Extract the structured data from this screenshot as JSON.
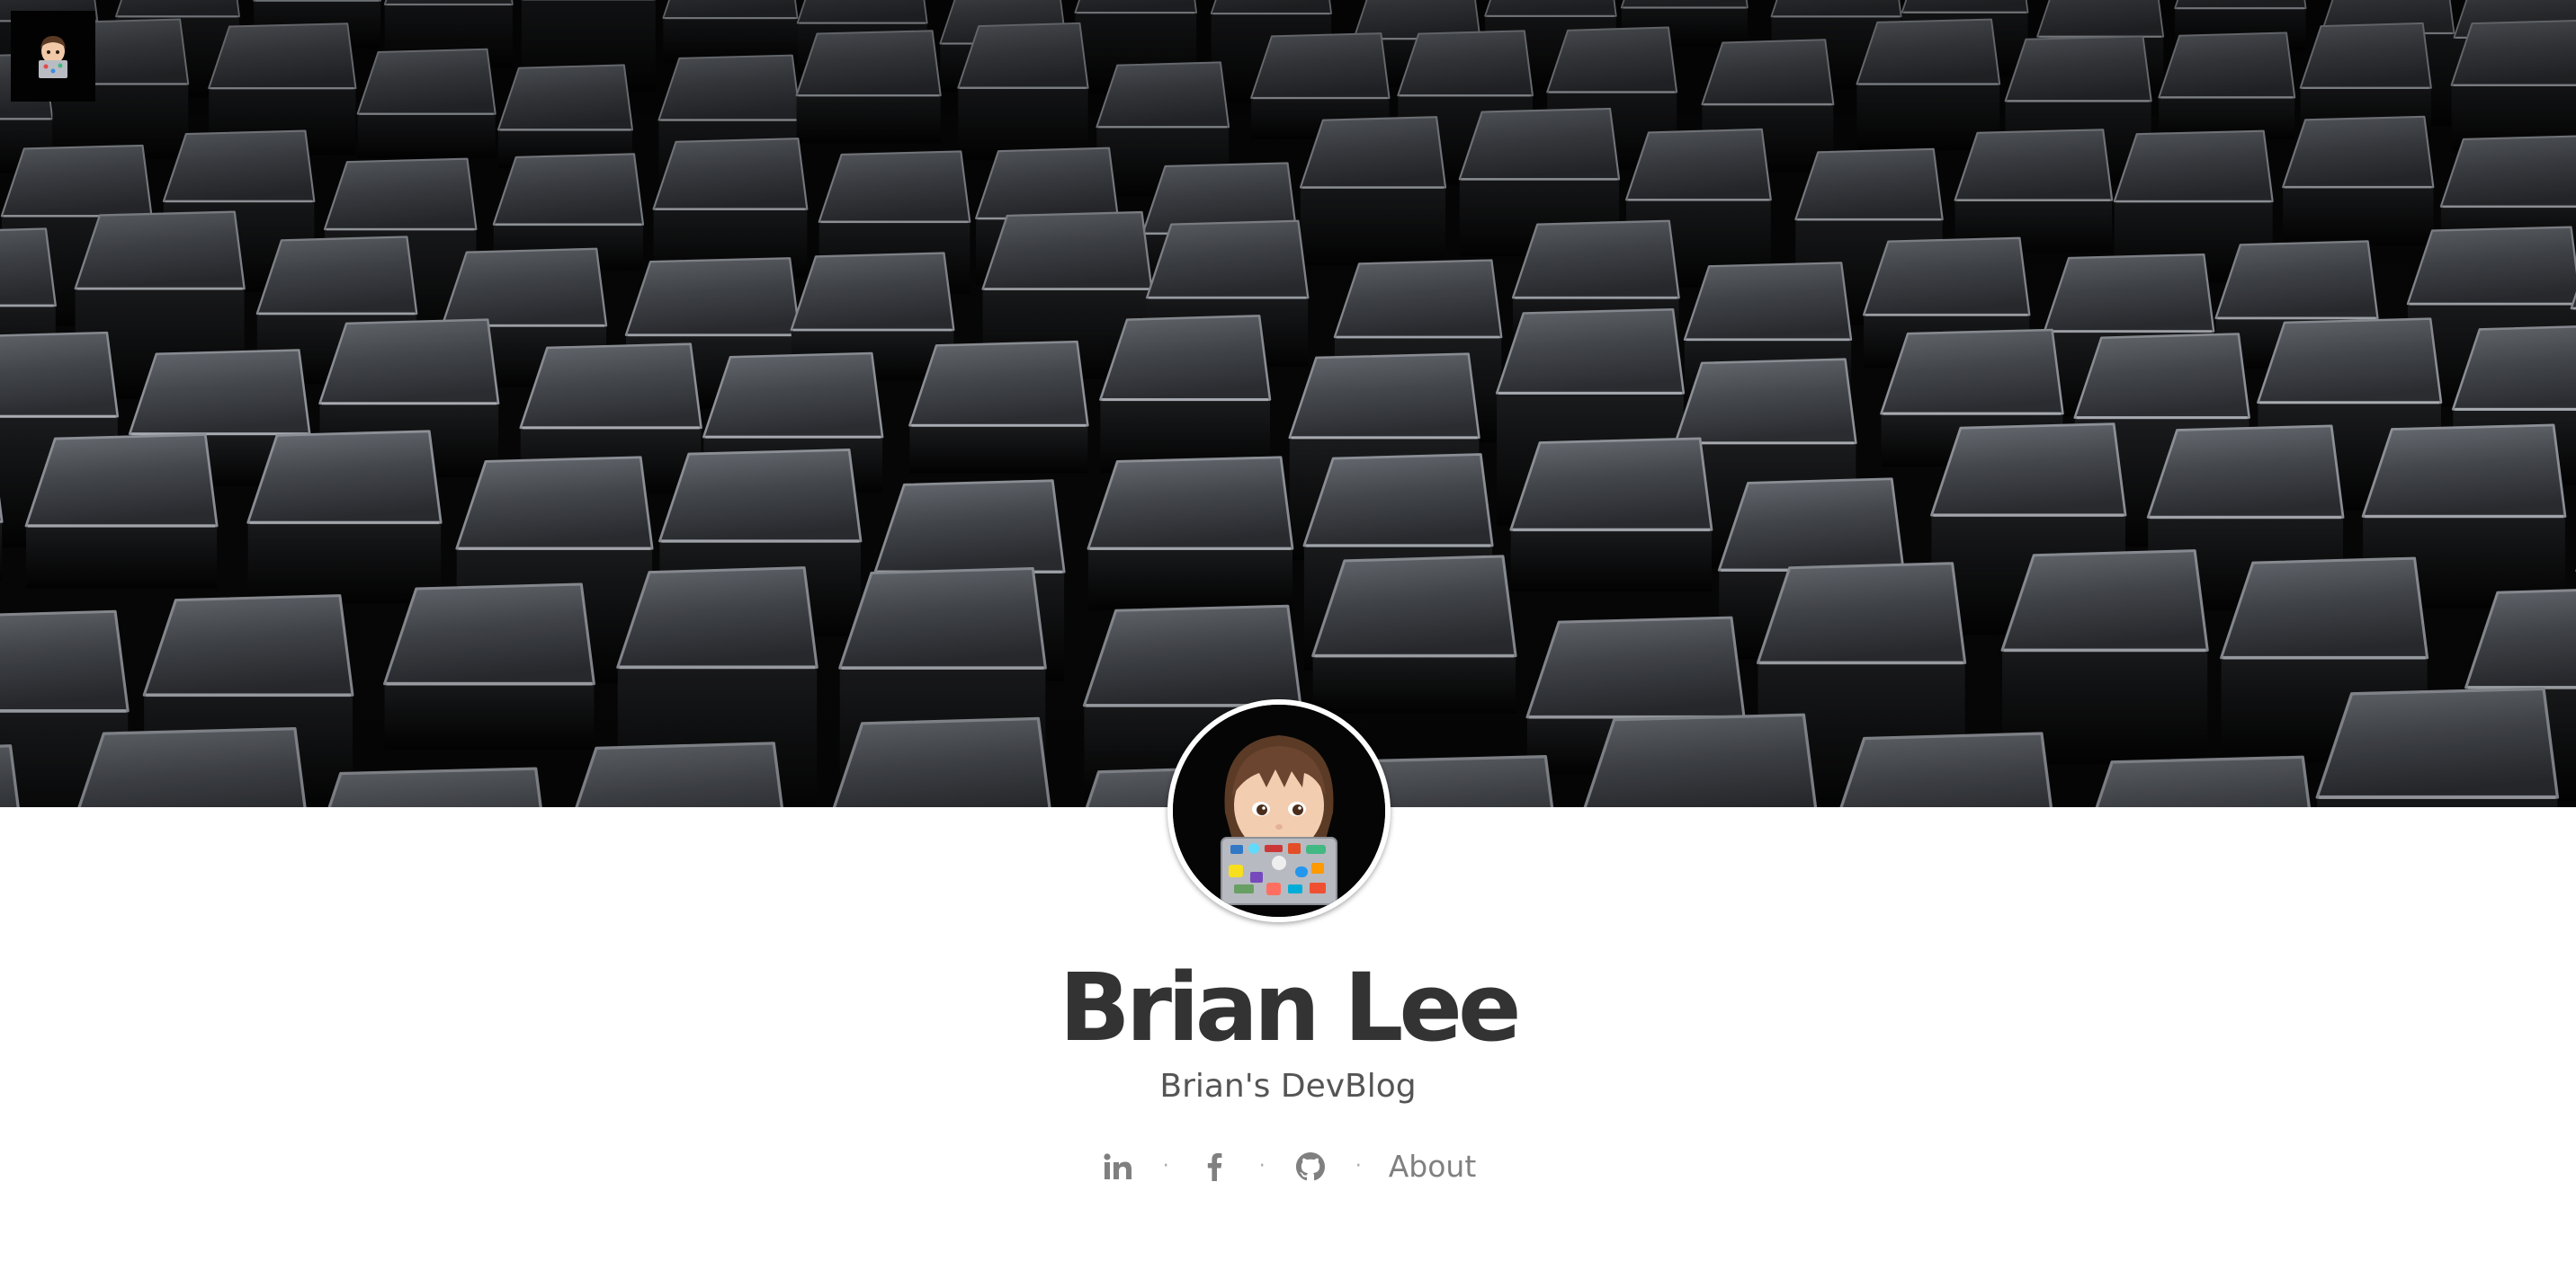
{
  "header": {
    "corner_avatar_icon": "memoji-avatar-icon",
    "hero_image": "black-glossy-cubes-background"
  },
  "profile": {
    "avatar_icon": "memoji-with-laptop-avatar-icon",
    "name": "Brian Lee",
    "tagline": "Brian's DevBlog"
  },
  "social": {
    "items": [
      {
        "icon": "linkedin-icon"
      },
      {
        "icon": "facebook-icon"
      },
      {
        "icon": "github-icon"
      }
    ],
    "separator": "·",
    "about_label": "About"
  },
  "colors": {
    "title": "#333333",
    "tagline": "#555555",
    "link": "#808080",
    "hero_bg": "#060606"
  }
}
